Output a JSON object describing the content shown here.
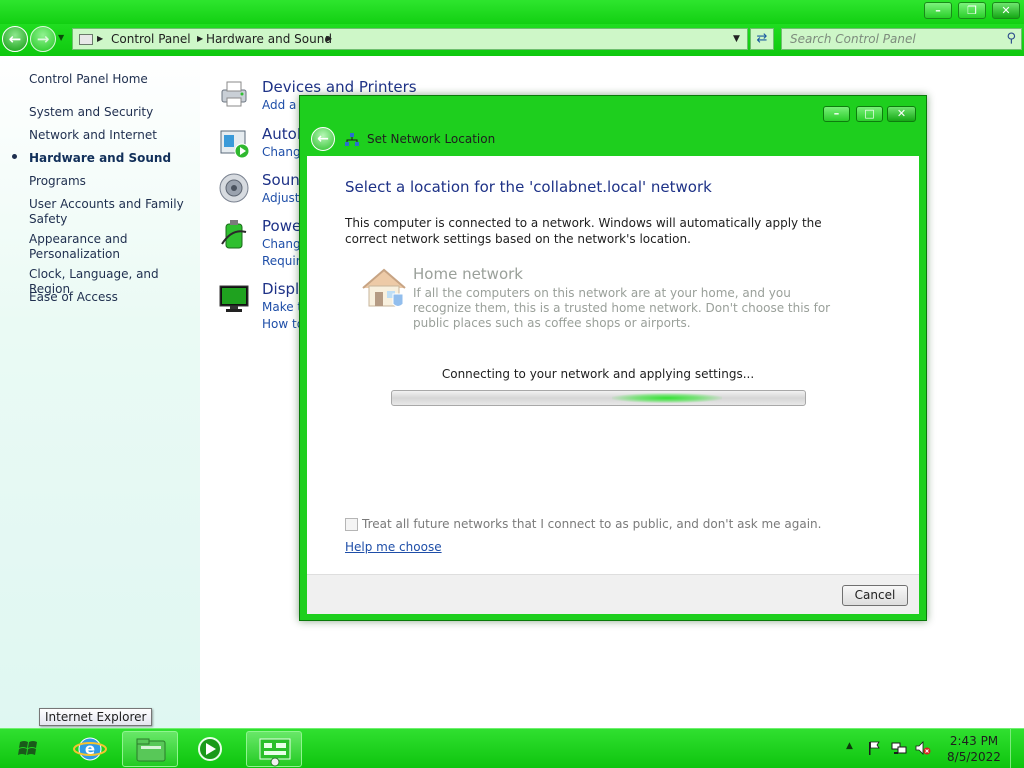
{
  "explorer": {
    "address": {
      "crumbs": [
        "Control Panel",
        "Hardware and Sound"
      ]
    },
    "search": {
      "placeholder": "Search Control Panel"
    },
    "left_pane": {
      "home": "Control Panel Home",
      "items": [
        "System and Security",
        "Network and Internet",
        "Hardware and Sound",
        "Programs",
        "User Accounts and Family Safety",
        "Appearance and Personalization",
        "Clock, Language, and Region",
        "Ease of Access"
      ],
      "active": "Hardware and Sound"
    },
    "categories": [
      {
        "title": "Devices and Printers",
        "links": [
          "Add a d"
        ]
      },
      {
        "title": "AutoP",
        "links": [
          "Change"
        ]
      },
      {
        "title": "Soun",
        "links": [
          "Adjust"
        ]
      },
      {
        "title": "Powe",
        "links": [
          "Change",
          "Require"
        ]
      },
      {
        "title": "Displ",
        "links": [
          "Make t",
          "How to"
        ]
      }
    ]
  },
  "dialog": {
    "window_title": "Set Network Location",
    "heading": "Select a location for the 'collabnet.local' network",
    "description": "This computer is connected to a network. Windows will automatically apply the correct network settings based on the network's location.",
    "home_network": {
      "title": "Home network",
      "description": "If all the computers on this network are at your home, and you recognize them, this is a trusted home network.  Don't choose this for public places such as coffee shops or airports."
    },
    "status": "Connecting to your network and applying settings...",
    "checkbox_label": "Treat all future networks that I connect to as public, and don't ask me again.",
    "checkbox_checked": false,
    "help_link": "Help me choose",
    "cancel_label": "Cancel"
  },
  "tooltip": "Internet Explorer",
  "taskbar": {
    "clock_time": "2:43 PM",
    "clock_date": "8/5/2022"
  },
  "colors": {
    "chrome": "#1ecf1e",
    "link": "#1e4ea8",
    "heading": "#1e3287"
  }
}
